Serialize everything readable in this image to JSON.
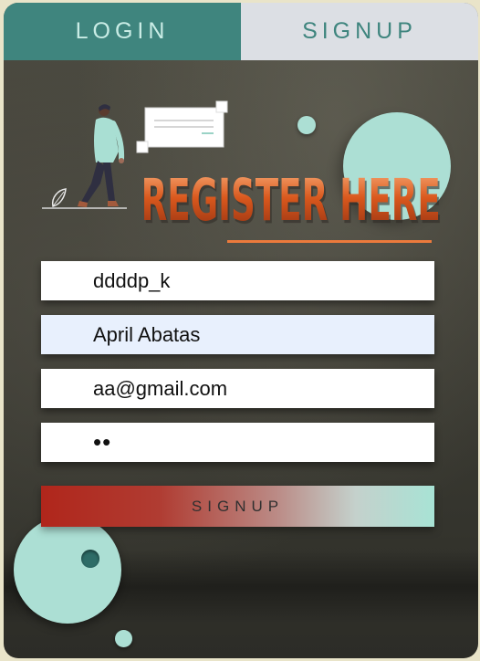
{
  "tabs": {
    "login_label": "LOGIN",
    "signup_label": "SIGNUP",
    "active": "signup"
  },
  "header": {
    "title": "REGISTER HERE"
  },
  "form": {
    "username": {
      "value": "ddddp_k",
      "placeholder": ""
    },
    "fullname": {
      "value": "April Abatas",
      "placeholder": ""
    },
    "email": {
      "value": "aa@gmail.com",
      "placeholder": ""
    },
    "password": {
      "value": "••"
    },
    "submit_label": "SIGNUP"
  },
  "colors": {
    "accent": "#3f857e",
    "mint": "#acdfd4",
    "tab_inactive": "#dcdfe4",
    "title_orange": "#d9581d",
    "submit_red": "#b0261b"
  },
  "icons": [
    "person-illustration",
    "message-card-icon",
    "leaf-icon"
  ]
}
